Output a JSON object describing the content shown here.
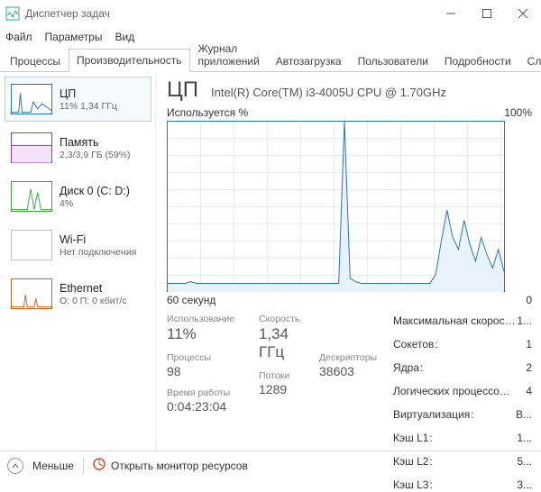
{
  "window": {
    "title": "Диспетчер задач"
  },
  "menu": {
    "file": "Файл",
    "options": "Параметры",
    "view": "Вид"
  },
  "tabs": {
    "processes": "Процессы",
    "performance": "Производительность",
    "apphistory": "Журнал приложений",
    "startup": "Автозагрузка",
    "users": "Пользователи",
    "details": "Подробности",
    "services": "Службы"
  },
  "sidebar": [
    {
      "title": "ЦП",
      "sub": "11% 1,34 ГГц",
      "color": "#2a73b8"
    },
    {
      "title": "Память",
      "sub": "2,3/3,9 ГБ (59%)",
      "color": "#8a3db5"
    },
    {
      "title": "Диск 0 (C: D:)",
      "sub": "4%",
      "color": "#3da83d"
    },
    {
      "title": "Wi-Fi",
      "sub": "Нет подключения",
      "color": "#bbb"
    },
    {
      "title": "Ethernet",
      "sub": "О: 0  П: 0 кбит/с",
      "color": "#c9641c"
    }
  ],
  "header": {
    "name": "ЦП",
    "model": "Intel(R) Core(TM) i3-4005U CPU @ 1.70GHz"
  },
  "chart_meta": {
    "tl": "Используется %",
    "tr": "100%",
    "bl": "60 секунд",
    "br": "0"
  },
  "stats": {
    "usage_l": "Использование",
    "usage_v": "11%",
    "speed_l": "Скорость",
    "speed_v": "1,34 ГГц",
    "proc_l": "Процессы",
    "proc_v": "98",
    "threads_l": "Потоки",
    "threads_v": "1289",
    "handles_l": "Дескрипторы",
    "handles_v": "38603",
    "uptime_l": "Время работы",
    "uptime_v": "0:04:23:04"
  },
  "info": [
    {
      "k": "Максимальная скорость",
      "v": "1..."
    },
    {
      "k": "Сокетов",
      "v": "1"
    },
    {
      "k": "Ядра",
      "v": "2"
    },
    {
      "k": "Логических процессоров",
      "v": "4"
    },
    {
      "k": "Виртуализация",
      "v": "В..."
    },
    {
      "k": "Кэш L1",
      "v": "1..."
    },
    {
      "k": "Кэш L2",
      "v": "5..."
    },
    {
      "k": "Кэш L3",
      "v": "3..."
    }
  ],
  "footer": {
    "less": "Меньше",
    "resmon": "Открыть монитор ресурсов"
  },
  "chart_data": {
    "type": "line",
    "title": "Используется %",
    "xlabel": "60 секунд",
    "ylabel": "%",
    "ylim": [
      0,
      100
    ],
    "xrange": [
      60,
      0
    ],
    "values": [
      5,
      5,
      5,
      5,
      6,
      5,
      5,
      5,
      5,
      5,
      5,
      5,
      5,
      5,
      5,
      5,
      5,
      5,
      5,
      5,
      5,
      5,
      5,
      5,
      5,
      5,
      5,
      5,
      5,
      5,
      5,
      100,
      8,
      6,
      5,
      5,
      5,
      5,
      5,
      5,
      5,
      5,
      5,
      5,
      5,
      5,
      5,
      10,
      30,
      48,
      32,
      25,
      42,
      28,
      18,
      32,
      22,
      14,
      25,
      12
    ]
  }
}
